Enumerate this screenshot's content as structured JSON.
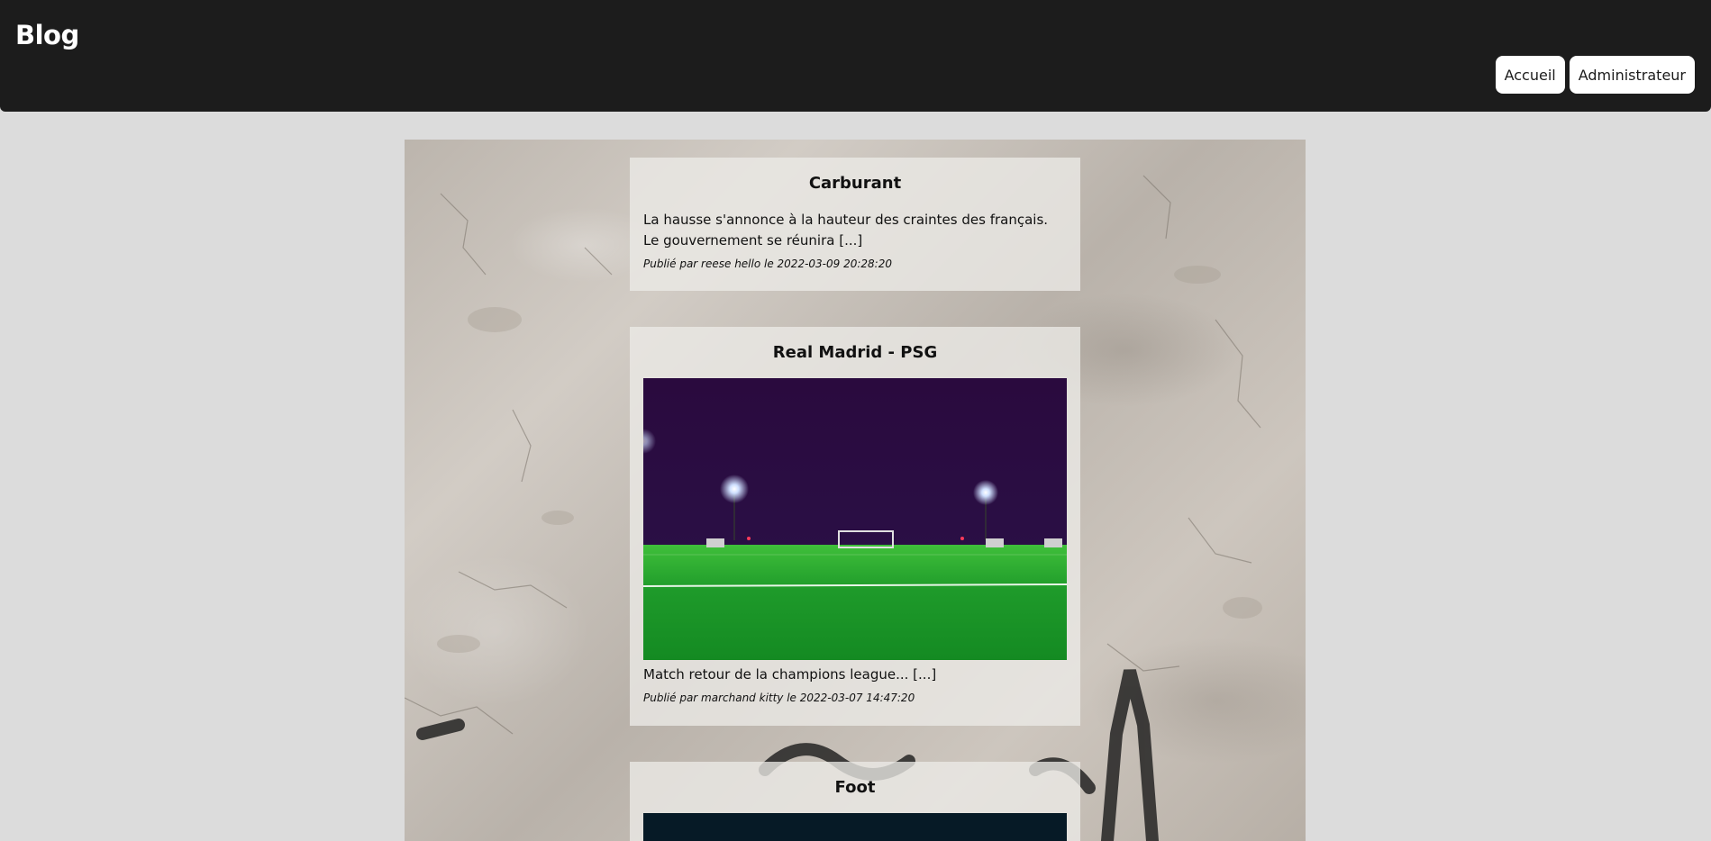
{
  "header": {
    "brand": "Blog",
    "nav": [
      {
        "label": "Accueil"
      },
      {
        "label": "Administrateur"
      }
    ]
  },
  "posts": [
    {
      "title": "Carburant",
      "excerpt": "La hausse s'annonce à la hauteur des craintes des français. Le gouvernement se réunira [...]",
      "meta": "Publié par reese hello le 2022-03-09 20:28:20"
    },
    {
      "title": "Real Madrid - PSG",
      "excerpt": "Match retour de la champions league... [...]",
      "meta": "Publié par marchand kitty le 2022-03-07 14:47:20"
    },
    {
      "title": "Foot"
    }
  ],
  "colors": {
    "header_bg": "#1c1c1c",
    "page_bg": "#dcdcdc",
    "button_bg": "#ffffff"
  }
}
